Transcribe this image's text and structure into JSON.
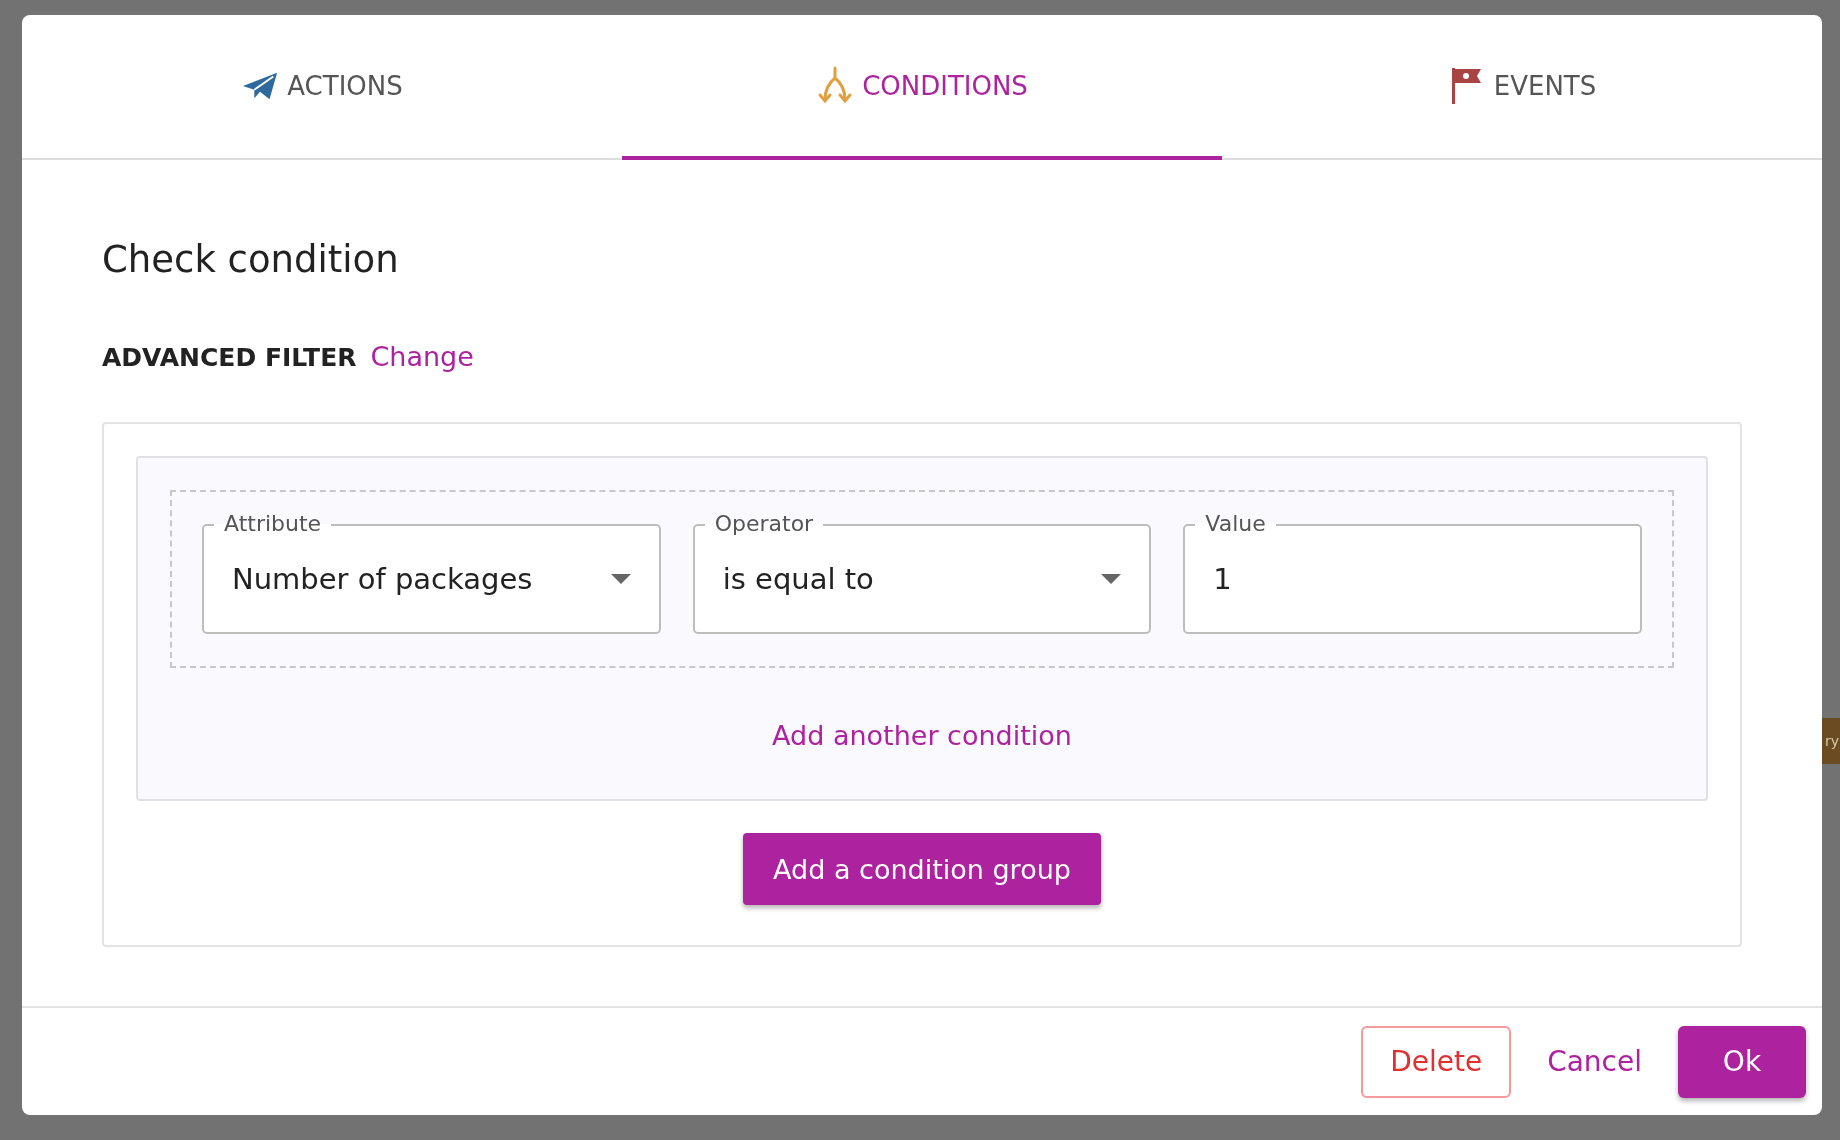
{
  "background": {
    "tag": "ry"
  },
  "tabs": [
    {
      "label": "ACTIONS",
      "kind": "plane",
      "selected": false
    },
    {
      "label": "CONDITIONS",
      "kind": "fork",
      "selected": true
    },
    {
      "label": "EVENTS",
      "kind": "flag",
      "selected": false
    }
  ],
  "title": "Check condition",
  "filter": {
    "label": "ADVANCED FILTER",
    "link": "Change"
  },
  "conditions": [
    {
      "label": "Attribute",
      "kind": "select",
      "value": "Number of packages"
    },
    {
      "label": "Operator",
      "kind": "select",
      "value": "is equal to"
    },
    {
      "label": "Value",
      "kind": "input",
      "value": "1"
    }
  ],
  "add_condition": "Add another condition",
  "add_group": "Add a condition group",
  "footer": {
    "delete": "Delete",
    "cancel": "Cancel",
    "ok": "Ok"
  }
}
